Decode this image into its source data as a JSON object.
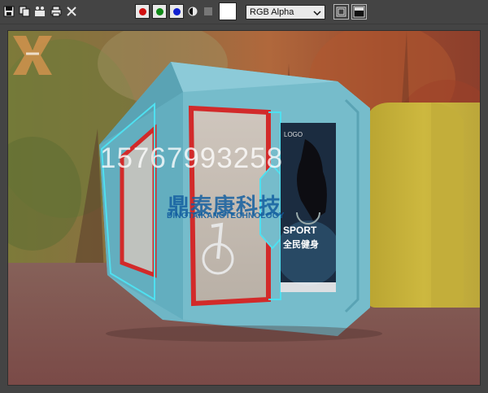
{
  "toolbar": {
    "icons": [
      "save-icon",
      "copy-icon",
      "clone-icon",
      "print-icon",
      "close-icon"
    ],
    "channels": [
      {
        "name": "red-channel",
        "color": "#d01010"
      },
      {
        "name": "green-channel",
        "color": "#108a18"
      },
      {
        "name": "blue-channel",
        "color": "#1020d0"
      }
    ],
    "channel_select": "RGB Alpha"
  },
  "viewport": {
    "watermark_phone": "15767993258",
    "watermark_company_cn": "鼎泰康科技",
    "watermark_company_en": "DINGTAIKANGTECHNOLOGY",
    "poster_logo": "LOGO",
    "poster_title_en": "SPORT",
    "poster_title_cn": "全民健身"
  },
  "colors": {
    "toolbar_bg": "#444444",
    "cabin_body": "#6fb6c6",
    "cabin_trim_red": "#d22a2a",
    "neon_outline": "#4fe0f0",
    "yellow_block": "#c9b53a",
    "floor": "#8a5a55"
  }
}
